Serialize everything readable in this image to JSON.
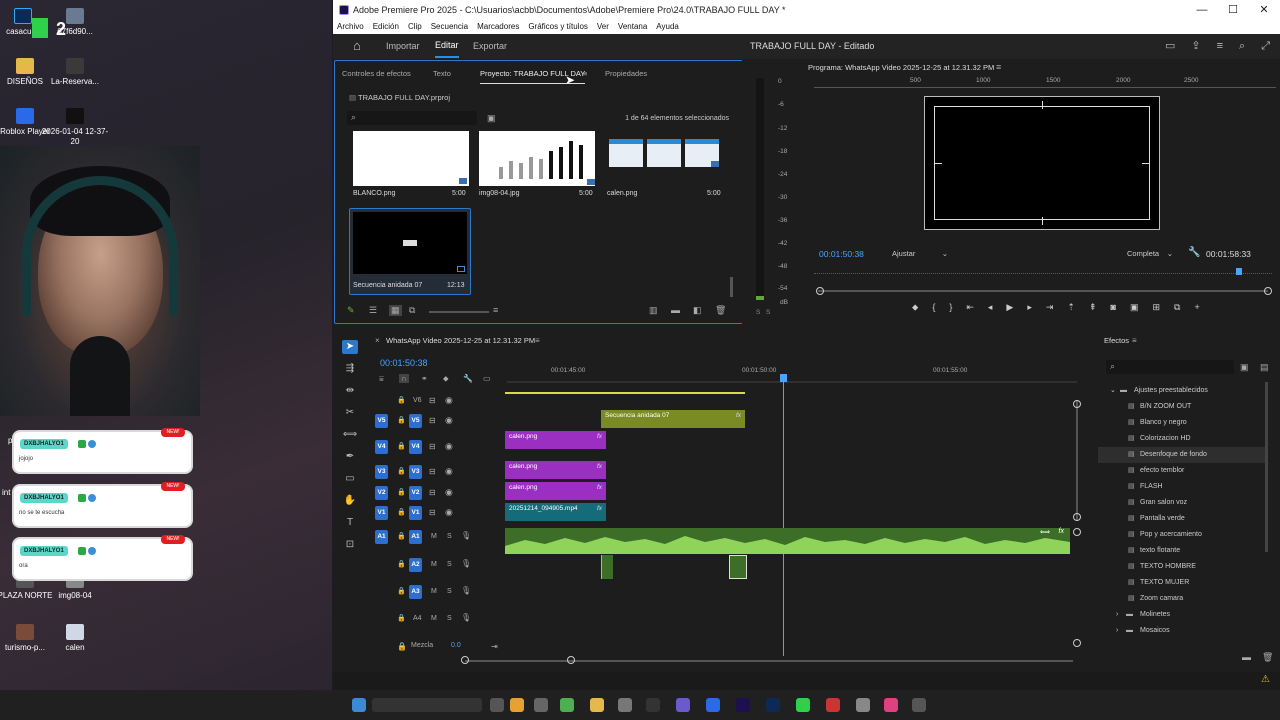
{
  "desktop": {
    "icons": [
      {
        "label": "casacul..."
      },
      {
        "label": "67f6d90..."
      },
      {
        "label": "DISEÑOS"
      },
      {
        "label": "La-Reserva..."
      },
      {
        "label": "Roblox Player"
      },
      {
        "label": "2026-01-04 12-37-20"
      },
      {
        "label": "PLAZA NORTE"
      },
      {
        "label": "img08-04"
      },
      {
        "label": "turismo-p..."
      },
      {
        "label": "calen"
      }
    ],
    "chat": [
      {
        "user": "DXBJHALYO1",
        "message": "jojojo",
        "badge": "NEW!"
      },
      {
        "user": "DXBJHALYO1",
        "message": "no se te escucha",
        "badge": "NEW!"
      },
      {
        "user": "DXBJHALYO1",
        "message": "ora",
        "badge": "NEW!"
      }
    ],
    "logo_text": "2",
    "side_fragments": {
      "p": "p",
      "int": "int"
    }
  },
  "window": {
    "title": "Adobe Premiere Pro 2025 - C:\\Usuarios\\acbb\\Documentos\\Adobe\\Premiere Pro\\24.0\\TRABAJO FULL DAY *",
    "controls": {
      "min": "—",
      "max": "☐",
      "close": "✕"
    }
  },
  "menu": [
    "Archivo",
    "Edición",
    "Clip",
    "Secuencia",
    "Marcadores",
    "Gráficos y títulos",
    "Ver",
    "Ventana",
    "Ayuda"
  ],
  "workspace": {
    "tabs": [
      {
        "label": "Importar"
      },
      {
        "label": "Editar"
      },
      {
        "label": "Exportar"
      }
    ],
    "document_title": "TRABAJO FULL DAY - Editado"
  },
  "project": {
    "tabs": [
      "Controles de efectos",
      "Texto",
      "Proyecto: TRABAJO FULL DAY",
      "Propiedades"
    ],
    "file": "TRABAJO FULL DAY.prproj",
    "selection": "1 de 64 elementos seleccionados",
    "items": [
      {
        "name": "BLANCO.png",
        "duration": "5:00"
      },
      {
        "name": "img08-04.jpg",
        "duration": "5:00"
      },
      {
        "name": "calen.png",
        "duration": "5:00"
      },
      {
        "name": "Secuencia anidada 07",
        "duration": "12:13"
      }
    ]
  },
  "audio_meter": {
    "scale": [
      "0",
      "-6",
      "-12",
      "-18",
      "-24",
      "-30",
      "-36",
      "-42",
      "-48",
      "-54",
      "dB"
    ],
    "footer": [
      "S",
      "S"
    ]
  },
  "program": {
    "title": "Programa: WhatsApp Video 2025-12-25 at 12.31.32 PM",
    "ruler": [
      "500",
      "1000",
      "1500",
      "2000",
      "2500"
    ],
    "timecode": "00:01:50:38",
    "fit": "Ajustar",
    "quality": "Completa",
    "duration": "00:01:58:33"
  },
  "timeline": {
    "title": "WhatsApp Video 2025-12-25 at 12.31.32 PM",
    "timecode": "00:01:50:38",
    "ruler": [
      "00:01:45:00",
      "00:01:50:00",
      "00:01:55:00"
    ],
    "video_tracks": [
      {
        "src": "",
        "name": "V6"
      },
      {
        "src": "V5",
        "name": "V5"
      },
      {
        "src": "V4",
        "name": "V4"
      },
      {
        "src": "V3",
        "name": "V3"
      },
      {
        "src": "V2",
        "name": "V2"
      },
      {
        "src": "V1",
        "name": "V1"
      }
    ],
    "audio_tracks": [
      {
        "src": "A1",
        "name": "A1"
      },
      {
        "src": "",
        "name": "A2"
      },
      {
        "src": "",
        "name": "A3"
      },
      {
        "src": "",
        "name": "A4"
      }
    ],
    "track_toggles": {
      "mute": "M",
      "solo": "S"
    },
    "clips": [
      {
        "name": "Secuencia anidada 07",
        "fx": "fx"
      },
      {
        "name": "calen.png",
        "fx": "fx"
      },
      {
        "name": "calen.png",
        "fx": "fx"
      },
      {
        "name": "calen.png",
        "fx": "fx"
      },
      {
        "name": "20251214_094905.mp4",
        "fx": "fx"
      }
    ],
    "mix_label": "Mezcla",
    "mix_value": "0.0"
  },
  "effects": {
    "title": "Efectos",
    "folder": "Ajustes preestablecidos",
    "items": [
      "B/N ZOOM OUT",
      "Blanco y negro",
      "Colorizacion HD",
      "Desenfoque de fondo",
      "efecto temblor",
      "FLASH",
      "Gran salon voz",
      "Pantalla verde",
      "Pop y acercamiento",
      "texto flotante",
      "TEXTO HOMBRE",
      "TEXTO MUJER",
      "Zoom camara"
    ],
    "selected_index": 3,
    "subfolders": [
      "Molinetes",
      "Mosaicos"
    ]
  },
  "colors": {
    "accent": "#2d8ceb",
    "clip_purple": "#9b2fc1",
    "clip_olive": "#7a8a24",
    "clip_teal": "#166b7a",
    "audio_green": "#5fa83a",
    "timecode": "#4aa3ff"
  }
}
